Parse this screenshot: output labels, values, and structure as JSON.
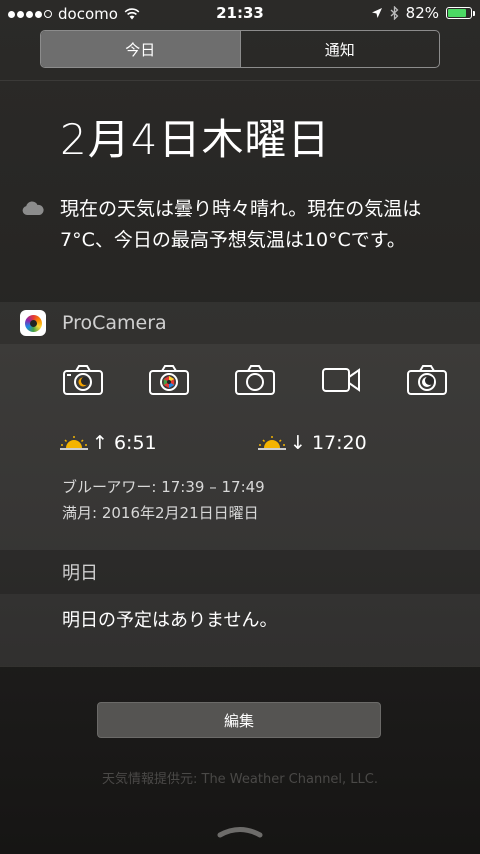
{
  "status_bar": {
    "carrier": "docomo",
    "signal_bars_filled": 4,
    "signal_bars_total": 5,
    "time": "21:33",
    "battery_text": "82%",
    "battery_level": 0.82
  },
  "tabs": [
    {
      "label": "今日",
      "active": true
    },
    {
      "label": "通知",
      "active": false
    }
  ],
  "today": {
    "date": "2月4日木曜日",
    "weather_icon": "cloud-icon",
    "weather_text": "現在の天気は曇り時々晴れ。現在の気温は7°C、今日の最高予想気温は10°Cです。"
  },
  "procamera": {
    "title": "ProCamera",
    "icons": [
      "camera-selfie-icon",
      "camera-color-icon",
      "camera-icon",
      "video-icon",
      "camera-night-icon"
    ],
    "sunrise": "↑ 6:51",
    "sunset": "↓ 17:20",
    "blue_hour": "ブルーアワー: 17:39 – 17:49",
    "full_moon": "満月: 2016年2月21日日曜日"
  },
  "tomorrow": {
    "header": "明日",
    "text": "明日の予定はありません。"
  },
  "edit_label": "編集",
  "credit": "天気情報提供元: The Weather Channel, LLC.",
  "colors": {
    "battery": "#4cd964",
    "active_tab": "#6e6e6e"
  }
}
